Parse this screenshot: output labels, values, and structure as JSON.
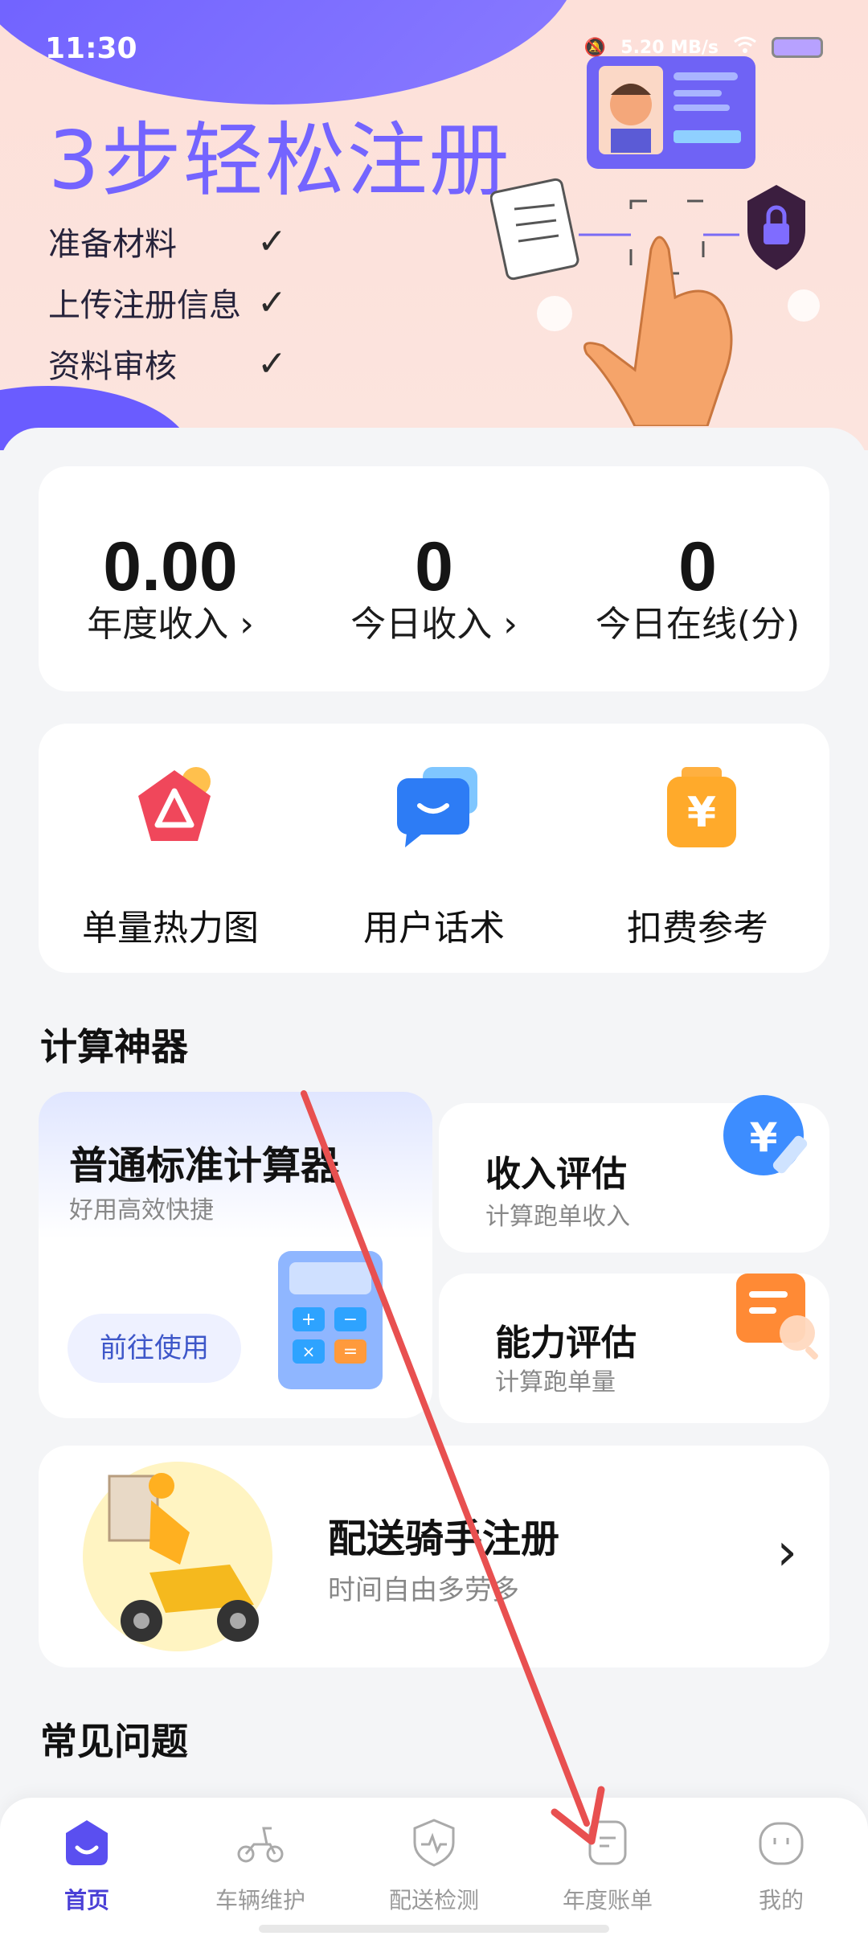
{
  "status_bar": {
    "time": "11:30",
    "net_speed": "5.20 MB/s"
  },
  "hero": {
    "title": "3步轻松注册",
    "steps": [
      {
        "label": "准备材料",
        "check": "✓"
      },
      {
        "label": "上传注册信息",
        "check": "✓"
      },
      {
        "label": "资料审核",
        "check": "✓"
      }
    ]
  },
  "stats": [
    {
      "value": "0.00",
      "label": "年度收入 ›"
    },
    {
      "value": "0",
      "label": "今日收入 ›"
    },
    {
      "value": "0",
      "label": "今日在线(分)"
    }
  ],
  "tools": [
    {
      "label": "单量热力图",
      "icon": "heatmap-icon"
    },
    {
      "label": "用户话术",
      "icon": "chat-bubble-icon"
    },
    {
      "label": "扣费参考",
      "icon": "yuan-tag-icon"
    }
  ],
  "calculators": {
    "section_title": "计算神器",
    "main": {
      "title": "普通标准计算器",
      "subtitle": "好用高效快捷",
      "button": "前往使用"
    },
    "income": {
      "title": "收入评估",
      "subtitle": "计算跑单收入"
    },
    "ability": {
      "title": "能力评估",
      "subtitle": "计算跑单量"
    }
  },
  "rider": {
    "title": "配送骑手注册",
    "subtitle": "时间自由多劳多",
    "chevron": "›"
  },
  "faq": {
    "section_title": "常见问题"
  },
  "tabbar": [
    {
      "label": "首页",
      "icon": "home-face-icon",
      "active": true
    },
    {
      "label": "车辆维护",
      "icon": "scooter-icon",
      "active": false
    },
    {
      "label": "配送检测",
      "icon": "shield-pulse-icon",
      "active": false
    },
    {
      "label": "年度账单",
      "icon": "bill-icon",
      "active": false
    },
    {
      "label": "我的",
      "icon": "profile-face-icon",
      "active": false
    }
  ],
  "colors": {
    "accent": "#6a5cff",
    "hero_bg": "#fde0d9",
    "annotation_arrow": "#e85050"
  }
}
